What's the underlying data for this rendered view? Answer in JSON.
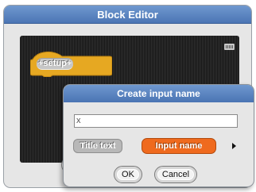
{
  "block_editor": {
    "title": "Block Editor",
    "prototype_block": {
      "label": "+setup+",
      "color": "#e6a822"
    },
    "keyboard_icon": "keyboard-icon"
  },
  "dialog": {
    "title": "Create input name",
    "input": {
      "value": "x"
    },
    "options": {
      "title_text": "Title text",
      "input_name": "Input name",
      "selected": "Input name",
      "selected_color": "#ef6a1e"
    },
    "expand_icon": "triangle-right-icon",
    "ok_label": "OK",
    "cancel_label": "Cancel"
  },
  "colors": {
    "titlebar": "#5a84c2",
    "panel": "#e6e6e6",
    "script_area": "#262626"
  }
}
